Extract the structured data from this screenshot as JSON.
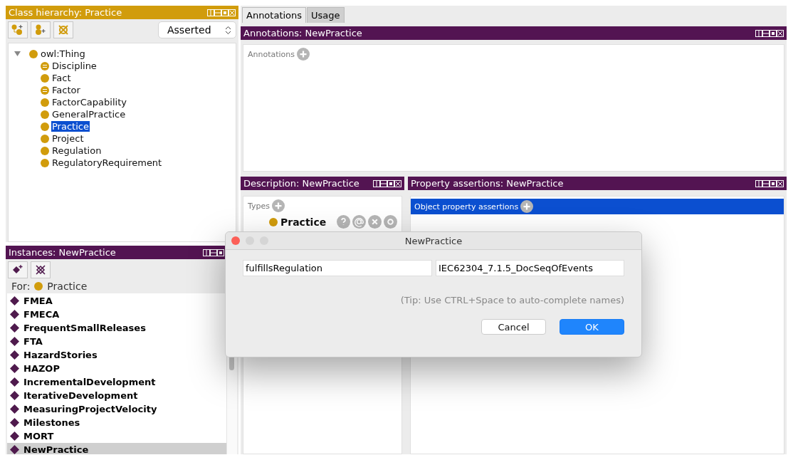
{
  "class_hierarchy": {
    "title": "Class hierarchy: Practice",
    "mode_select": {
      "value": "Asserted"
    },
    "tree": {
      "label": "owl:Thing",
      "expanded": true,
      "children": [
        {
          "label": "Discipline",
          "kind": "defined",
          "selected": false
        },
        {
          "label": "Fact",
          "kind": "primitive",
          "selected": false
        },
        {
          "label": "Factor",
          "kind": "defined",
          "selected": false
        },
        {
          "label": "FactorCapability",
          "kind": "primitive",
          "selected": false
        },
        {
          "label": "GeneralPractice",
          "kind": "primitive",
          "selected": false
        },
        {
          "label": "Practice",
          "kind": "primitive",
          "selected": true
        },
        {
          "label": "Project",
          "kind": "primitive",
          "selected": false
        },
        {
          "label": "Regulation",
          "kind": "primitive",
          "selected": false
        },
        {
          "label": "RegulatoryRequirement",
          "kind": "primitive",
          "selected": false
        }
      ]
    }
  },
  "instances": {
    "title": "Instances: NewPractice",
    "for_label": "For:",
    "for_class": "Practice",
    "items": [
      {
        "label": "FMEA",
        "selected": false
      },
      {
        "label": "FMECA",
        "selected": false
      },
      {
        "label": "FrequentSmallReleases",
        "selected": false
      },
      {
        "label": "FTA",
        "selected": false
      },
      {
        "label": "HazardStories",
        "selected": false
      },
      {
        "label": "HAZOP",
        "selected": false
      },
      {
        "label": "IncrementalDevelopment",
        "selected": false
      },
      {
        "label": "IterativeDevelopment",
        "selected": false
      },
      {
        "label": "MeasuringProjectVelocity",
        "selected": false
      },
      {
        "label": "Milestones",
        "selected": false
      },
      {
        "label": "MORT",
        "selected": false
      },
      {
        "label": "NewPractice",
        "selected": true
      }
    ]
  },
  "tabs": [
    {
      "label": "Annotations",
      "selected": true
    },
    {
      "label": "Usage",
      "selected": false
    }
  ],
  "annotations": {
    "title": "Annotations: NewPractice",
    "section": "Annotations"
  },
  "description": {
    "title": "Description: NewPractice",
    "section": "Types",
    "types": [
      "Practice"
    ]
  },
  "property_assertions": {
    "title": "Property assertions: NewPractice",
    "section": "Object property assertions"
  },
  "dialog": {
    "title": "NewPractice",
    "property": "fulfillsRegulation",
    "value": "IEC62304_7.1.5_DocSeqOfEvents",
    "tip": "(Tip: Use CTRL+Space to auto-complete names)",
    "buttons": [
      {
        "label": "Cancel",
        "kind": "default"
      },
      {
        "label": "OK",
        "kind": "primary"
      }
    ]
  }
}
